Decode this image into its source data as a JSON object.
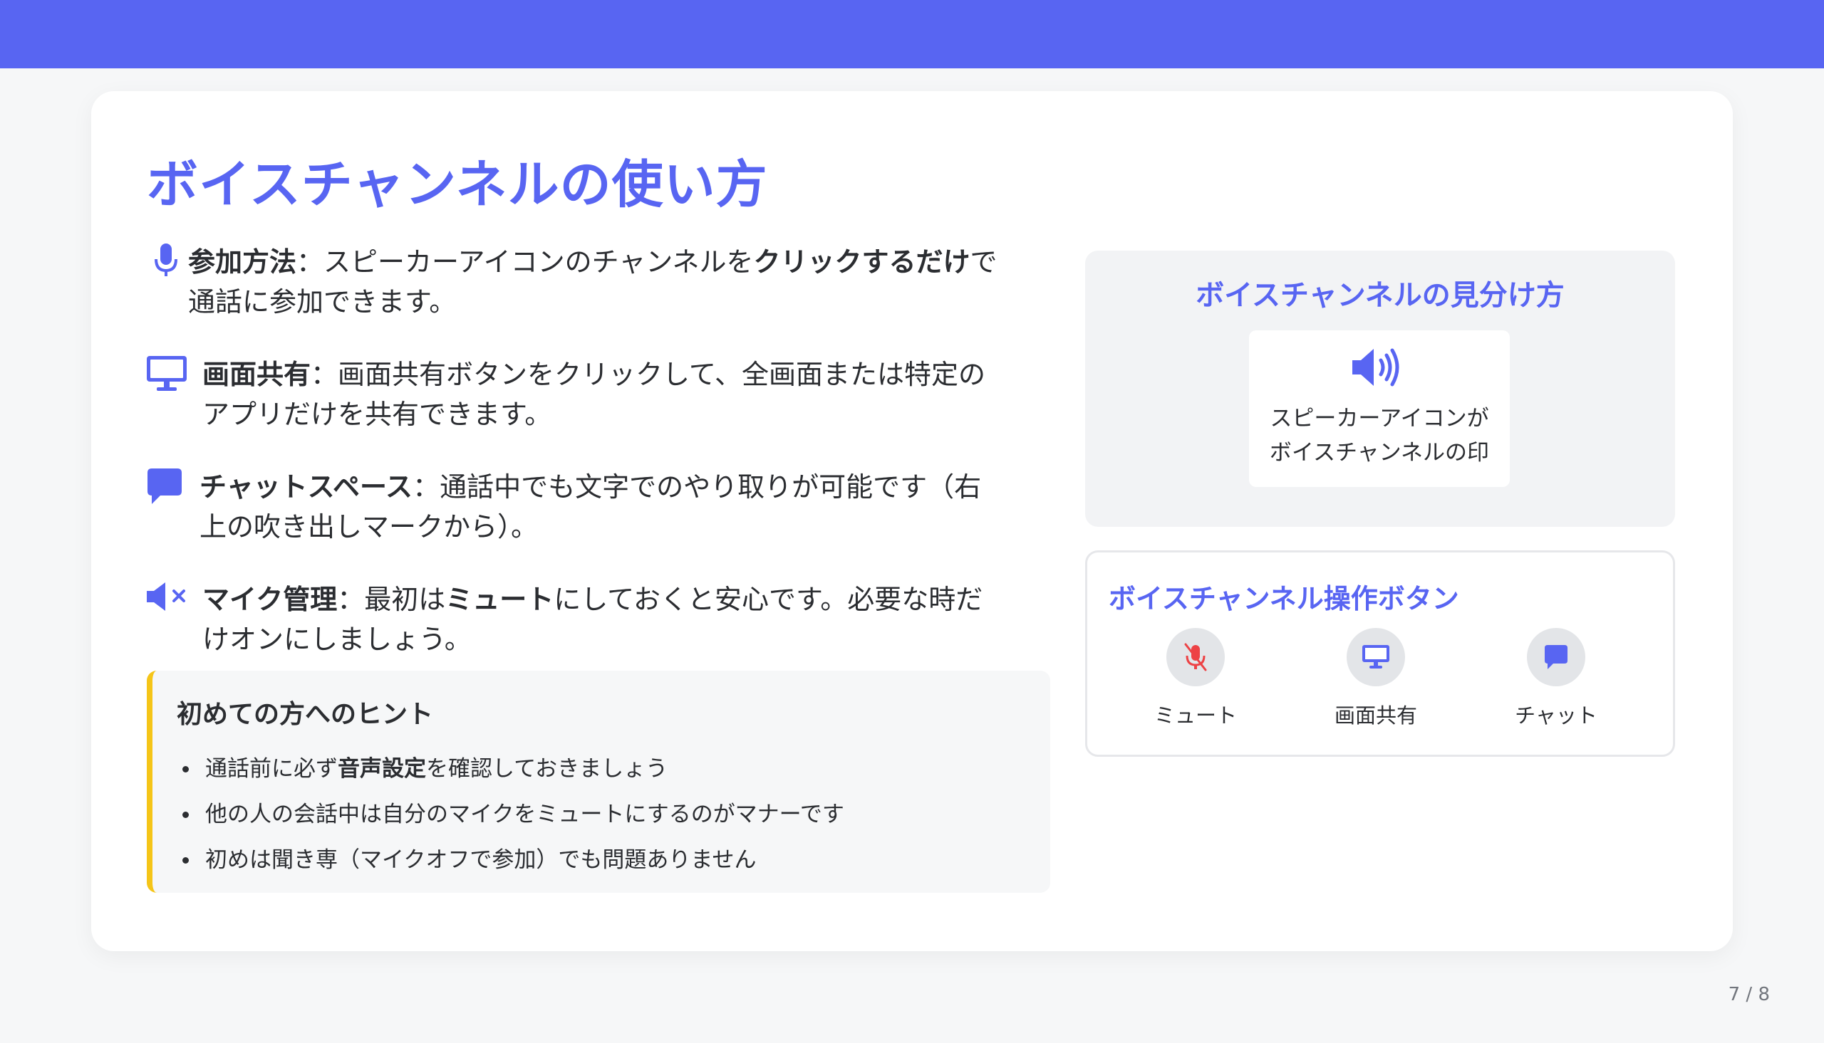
{
  "colors": {
    "accent": "#5865f2",
    "hint_border": "#f5c518",
    "mute_red": "#ed4245"
  },
  "title": "ボイスチャンネルの使い方",
  "features": [
    {
      "icon": "microphone-icon",
      "label": "参加方法",
      "sep": "：",
      "text1": "スピーカーアイコンのチャンネルを",
      "bold2": "クリックするだけ",
      "text2": "で通話に参加できます。"
    },
    {
      "icon": "monitor-icon",
      "label": "画面共有",
      "sep": "：",
      "text1": "画面共有ボタンをクリックして、全画面または特定のアプリだけを共有できます。"
    },
    {
      "icon": "chat-bubble-icon",
      "label": "チャットスペース",
      "sep": "：",
      "text1": "通話中でも文字でのやり取りが可能です（右上の吹き出しマークから）。"
    },
    {
      "icon": "speaker-mute-icon",
      "label": "マイク管理",
      "sep": "：",
      "text1": "最初は",
      "bold2": "ミュート",
      "text2": "にしておくと安心です。必要な時だけオンにしましょう。"
    }
  ],
  "hint": {
    "title": "初めての方へのヒント",
    "items": [
      {
        "pre": "通話前に必ず",
        "bold": "音声設定",
        "post": "を確認しておきましょう"
      },
      {
        "pre": "他の人の会話中は自分のマイクをミュートにするのがマナーです"
      },
      {
        "pre": "初めは聞き専（マイクオフで参加）でも問題ありません"
      }
    ]
  },
  "identify": {
    "title": "ボイスチャンネルの見分け方",
    "icon": "speaker-volume-icon",
    "caption_line1": "スピーカーアイコンが",
    "caption_line2": "ボイスチャンネルの印"
  },
  "controls": {
    "title": "ボイスチャンネル操作ボタン",
    "buttons": [
      {
        "label": "ミュート",
        "icon": "mic-muted-icon"
      },
      {
        "label": "画面共有",
        "icon": "monitor-icon"
      },
      {
        "label": "チャット",
        "icon": "chat-bubble-icon"
      }
    ]
  },
  "page_number": "7 / 8"
}
